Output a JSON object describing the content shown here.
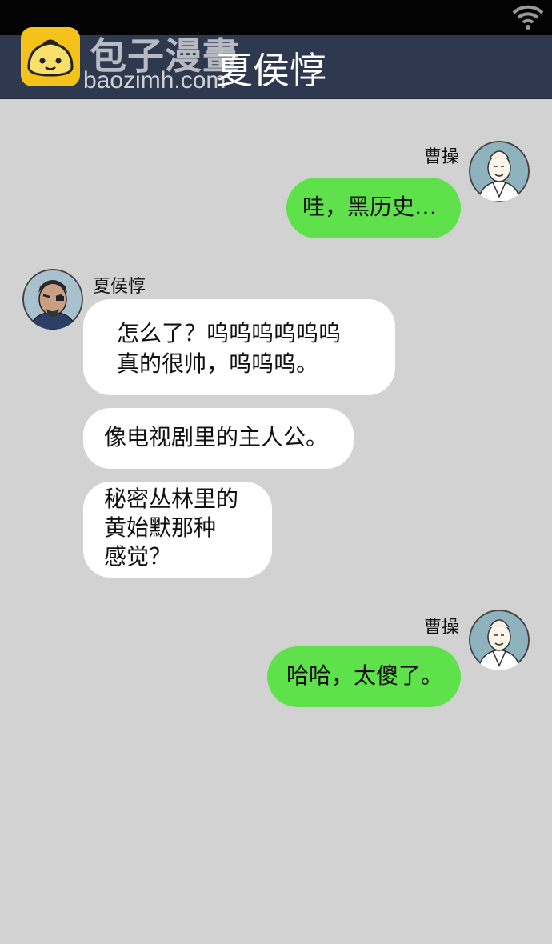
{
  "status_bar": {
    "wifi_icon": "wifi-icon"
  },
  "watermark": {
    "site_name": "包子漫畫",
    "url": "baozimh.com",
    "logo_icon": "bun-logo-icon"
  },
  "header": {
    "title": "夏侯惇"
  },
  "messages": [
    {
      "sender": "曹操",
      "side": "right",
      "avatar_icon": "caocao-avatar-icon",
      "bubbles": [
        {
          "lines": [
            "哇，黑历史…"
          ]
        }
      ]
    },
    {
      "sender": "夏侯惇",
      "side": "left",
      "avatar_icon": "xiahoudun-avatar-icon",
      "bubbles": [
        {
          "lines": [
            "怎么了？呜呜呜呜呜呜",
            "真的很帅，呜呜呜。"
          ]
        },
        {
          "lines": [
            "像电视剧里的主人公。"
          ]
        },
        {
          "lines": [
            "秘密丛林里的",
            "黄始默那种",
            "感觉？"
          ]
        }
      ]
    },
    {
      "sender": "曹操",
      "side": "right",
      "avatar_icon": "caocao-avatar-icon",
      "bubbles": [
        {
          "lines": [
            "哈哈，太傻了。"
          ]
        }
      ]
    }
  ],
  "colors": {
    "background": "#d2d2d2",
    "header": "#2e3950",
    "outgoing_bubble": "#5ee14a",
    "incoming_bubble": "#ffffff"
  }
}
